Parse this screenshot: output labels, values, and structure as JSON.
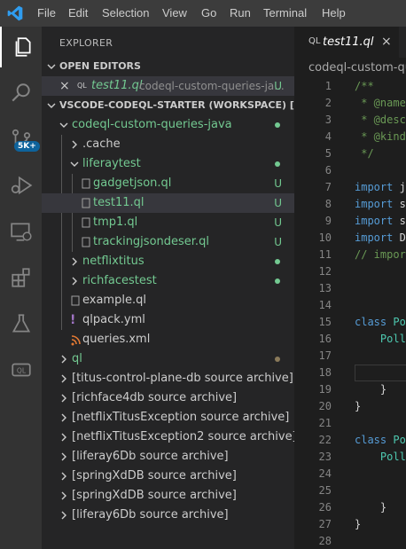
{
  "menu": [
    "File",
    "Edit",
    "Selection",
    "View",
    "Go",
    "Run",
    "Terminal",
    "Help"
  ],
  "activity": {
    "badge": "5K+"
  },
  "explorer": {
    "title": "EXPLORER",
    "open_editors_title": "OPEN EDITORS",
    "open_editor": {
      "close": "×",
      "icon": "QL",
      "name": "test11.ql",
      "path": "codeql-custom-queries-ja...",
      "status": "U"
    },
    "workspace_title": "VSCODE-CODEQL-STARTER (WORKSPACE) [WSL: ..."
  },
  "tree": [
    {
      "label": "codeql-custom-queries-java",
      "status": "",
      "dot": "#73c991"
    },
    {
      "label": ".cache",
      "status": "",
      "dot": ""
    },
    {
      "label": "liferaytest",
      "status": "",
      "dot": "#73c991"
    },
    {
      "label": "gadgetjson.ql",
      "status": "U",
      "dot": ""
    },
    {
      "label": "test11.ql",
      "status": "U",
      "dot": ""
    },
    {
      "label": "tmp1.ql",
      "status": "U",
      "dot": ""
    },
    {
      "label": "trackingjsondeser.ql",
      "status": "U",
      "dot": ""
    },
    {
      "label": "netflixtitus",
      "status": "",
      "dot": "#73c991"
    },
    {
      "label": "richfacestest",
      "status": "",
      "dot": "#73c991"
    },
    {
      "label": "example.ql",
      "status": "",
      "dot": ""
    },
    {
      "label": "qlpack.yml",
      "status": "",
      "dot": ""
    },
    {
      "label": "queries.xml",
      "status": "",
      "dot": ""
    },
    {
      "label": "ql",
      "status": "",
      "dot": "#8a7a5a"
    },
    {
      "label": "[titus-control-plane-db source archive]",
      "status": "",
      "dot": ""
    },
    {
      "label": "[richface4db source archive]",
      "status": "",
      "dot": ""
    },
    {
      "label": "[netflixTitusException source archive]",
      "status": "",
      "dot": ""
    },
    {
      "label": "[netflixTitusException2 source archive]",
      "status": "",
      "dot": ""
    },
    {
      "label": "[liferay6Db source archive]",
      "status": "",
      "dot": ""
    },
    {
      "label": "[springXdDB source archive]",
      "status": "",
      "dot": ""
    },
    {
      "label": "[springXdDB source archive]",
      "status": "",
      "dot": ""
    },
    {
      "label": "[liferay6Db source archive]",
      "status": "",
      "dot": ""
    }
  ],
  "editor": {
    "tab_name": "test11.ql",
    "tab_close": "×",
    "tab_icon": "QL",
    "breadcrumb": "codeql-custom-queries-java",
    "lines": [
      {
        "n": "1",
        "t": "/**"
      },
      {
        "n": "2",
        "t": " * @name"
      },
      {
        "n": "3",
        "t": " * @desc"
      },
      {
        "n": "4",
        "t": " * @kind"
      },
      {
        "n": "5",
        "t": " */"
      },
      {
        "n": "6",
        "t": ""
      },
      {
        "n": "7",
        "t": "import j"
      },
      {
        "n": "8",
        "t": "import s"
      },
      {
        "n": "9",
        "t": "import s"
      },
      {
        "n": "10",
        "t": "import D"
      },
      {
        "n": "11",
        "t": "// impor"
      },
      {
        "n": "12",
        "t": ""
      },
      {
        "n": "13",
        "t": ""
      },
      {
        "n": "14",
        "t": ""
      },
      {
        "n": "15",
        "t": "class Po"
      },
      {
        "n": "16",
        "t": "    Poll"
      },
      {
        "n": "17",
        "t": ""
      },
      {
        "n": "18",
        "t": ""
      },
      {
        "n": "19",
        "t": "    }"
      },
      {
        "n": "20",
        "t": "}"
      },
      {
        "n": "21",
        "t": ""
      },
      {
        "n": "22",
        "t": "class Po"
      },
      {
        "n": "23",
        "t": "    Poll"
      },
      {
        "n": "24",
        "t": ""
      },
      {
        "n": "25",
        "t": ""
      },
      {
        "n": "26",
        "t": "    }"
      },
      {
        "n": "27",
        "t": "}"
      },
      {
        "n": "28",
        "t": ""
      }
    ]
  }
}
